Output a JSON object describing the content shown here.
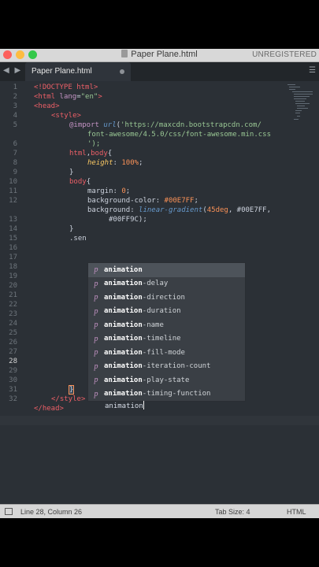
{
  "window": {
    "title": "Paper Plane.html",
    "registration": "UNREGISTERED"
  },
  "tab": {
    "label": "Paper Plane.html",
    "navigation": "◀ ▶",
    "menu": "☰"
  },
  "editor": {
    "line_numbers": [
      "1",
      "2",
      "3",
      "4",
      "5",
      "",
      "6",
      "7",
      "8",
      "9",
      "10",
      "11",
      "12",
      "",
      "13",
      "14",
      "15",
      "16",
      "17",
      "18",
      "19",
      "20",
      "21",
      "22",
      "23",
      "24",
      "25",
      "26",
      "27",
      "28",
      "29",
      "30",
      "31",
      "32"
    ],
    "current_line": "28"
  },
  "autocomplete": {
    "typed_prefix": "animation",
    "items": [
      {
        "kind": "p",
        "prefix": "animation",
        "rest": ""
      },
      {
        "kind": "p",
        "prefix": "animation",
        "rest": "-delay"
      },
      {
        "kind": "p",
        "prefix": "animation",
        "rest": "-direction"
      },
      {
        "kind": "p",
        "prefix": "animation",
        "rest": "-duration"
      },
      {
        "kind": "p",
        "prefix": "animation",
        "rest": "-name"
      },
      {
        "kind": "p",
        "prefix": "animation",
        "rest": "-timeline"
      },
      {
        "kind": "p",
        "prefix": "animation",
        "rest": "-fill-mode"
      },
      {
        "kind": "p",
        "prefix": "animation",
        "rest": "-iteration-count"
      },
      {
        "kind": "p",
        "prefix": "animation",
        "rest": "-play-state"
      },
      {
        "kind": "p",
        "prefix": "animation",
        "rest": "-timing-function"
      }
    ]
  },
  "status": {
    "position": "Line 28, Column 26",
    "tab_size": "Tab Size: 4",
    "syntax": "HTML"
  },
  "code": {
    "l1_a": "<!",
    "l1_b": "DOCTYPE html",
    "l1_c": ">",
    "l2_a": "<",
    "l2_b": "html",
    "l2_c": " lang",
    "l2_d": "=",
    "l2_e": "\"en\"",
    "l2_f": ">",
    "l3_a": "<",
    "l3_b": "head",
    "l3_c": ">",
    "l4_a": "<",
    "l4_b": "style",
    "l4_c": ">",
    "l5_a": "@import ",
    "l5_b": "url",
    "l5_c": "(",
    "l5_d": "'https://maxcdn.bootstrapcdn.com/",
    "l5w1": "font-awesome/4.5.0/css/font-awesome.min.css",
    "l5w2": "');",
    "l6_a": "html",
    "l6_b": ",",
    "l6_c": "body",
    "l6_d": "{",
    "l7_a": "height",
    "l7_b": ": ",
    "l7_c": "100%",
    "l7_d": ";",
    "l8": "}",
    "l9_a": "body",
    "l9_b": "{",
    "l10_a": "margin",
    "l10_b": ": ",
    "l10_c": "0",
    "l10_d": ";",
    "l11_a": "background-color",
    "l11_b": ": ",
    "l11_c": "#00E7FF",
    "l11_d": ";",
    "l12_a": "background",
    "l12_b": ": ",
    "l12_c": "linear-gradient",
    "l12_d": "(",
    "l12_e": "45deg",
    "l12_f": ", #00E7FF,",
    "l12w1": "#00FF9C);",
    "l13": "}",
    "l14": ".sen",
    "l29": "}",
    "l30_a": "</",
    "l30_b": "style",
    "l30_c": ">",
    "l31_a": "</",
    "l31_b": "head",
    "l31_c": ">"
  }
}
